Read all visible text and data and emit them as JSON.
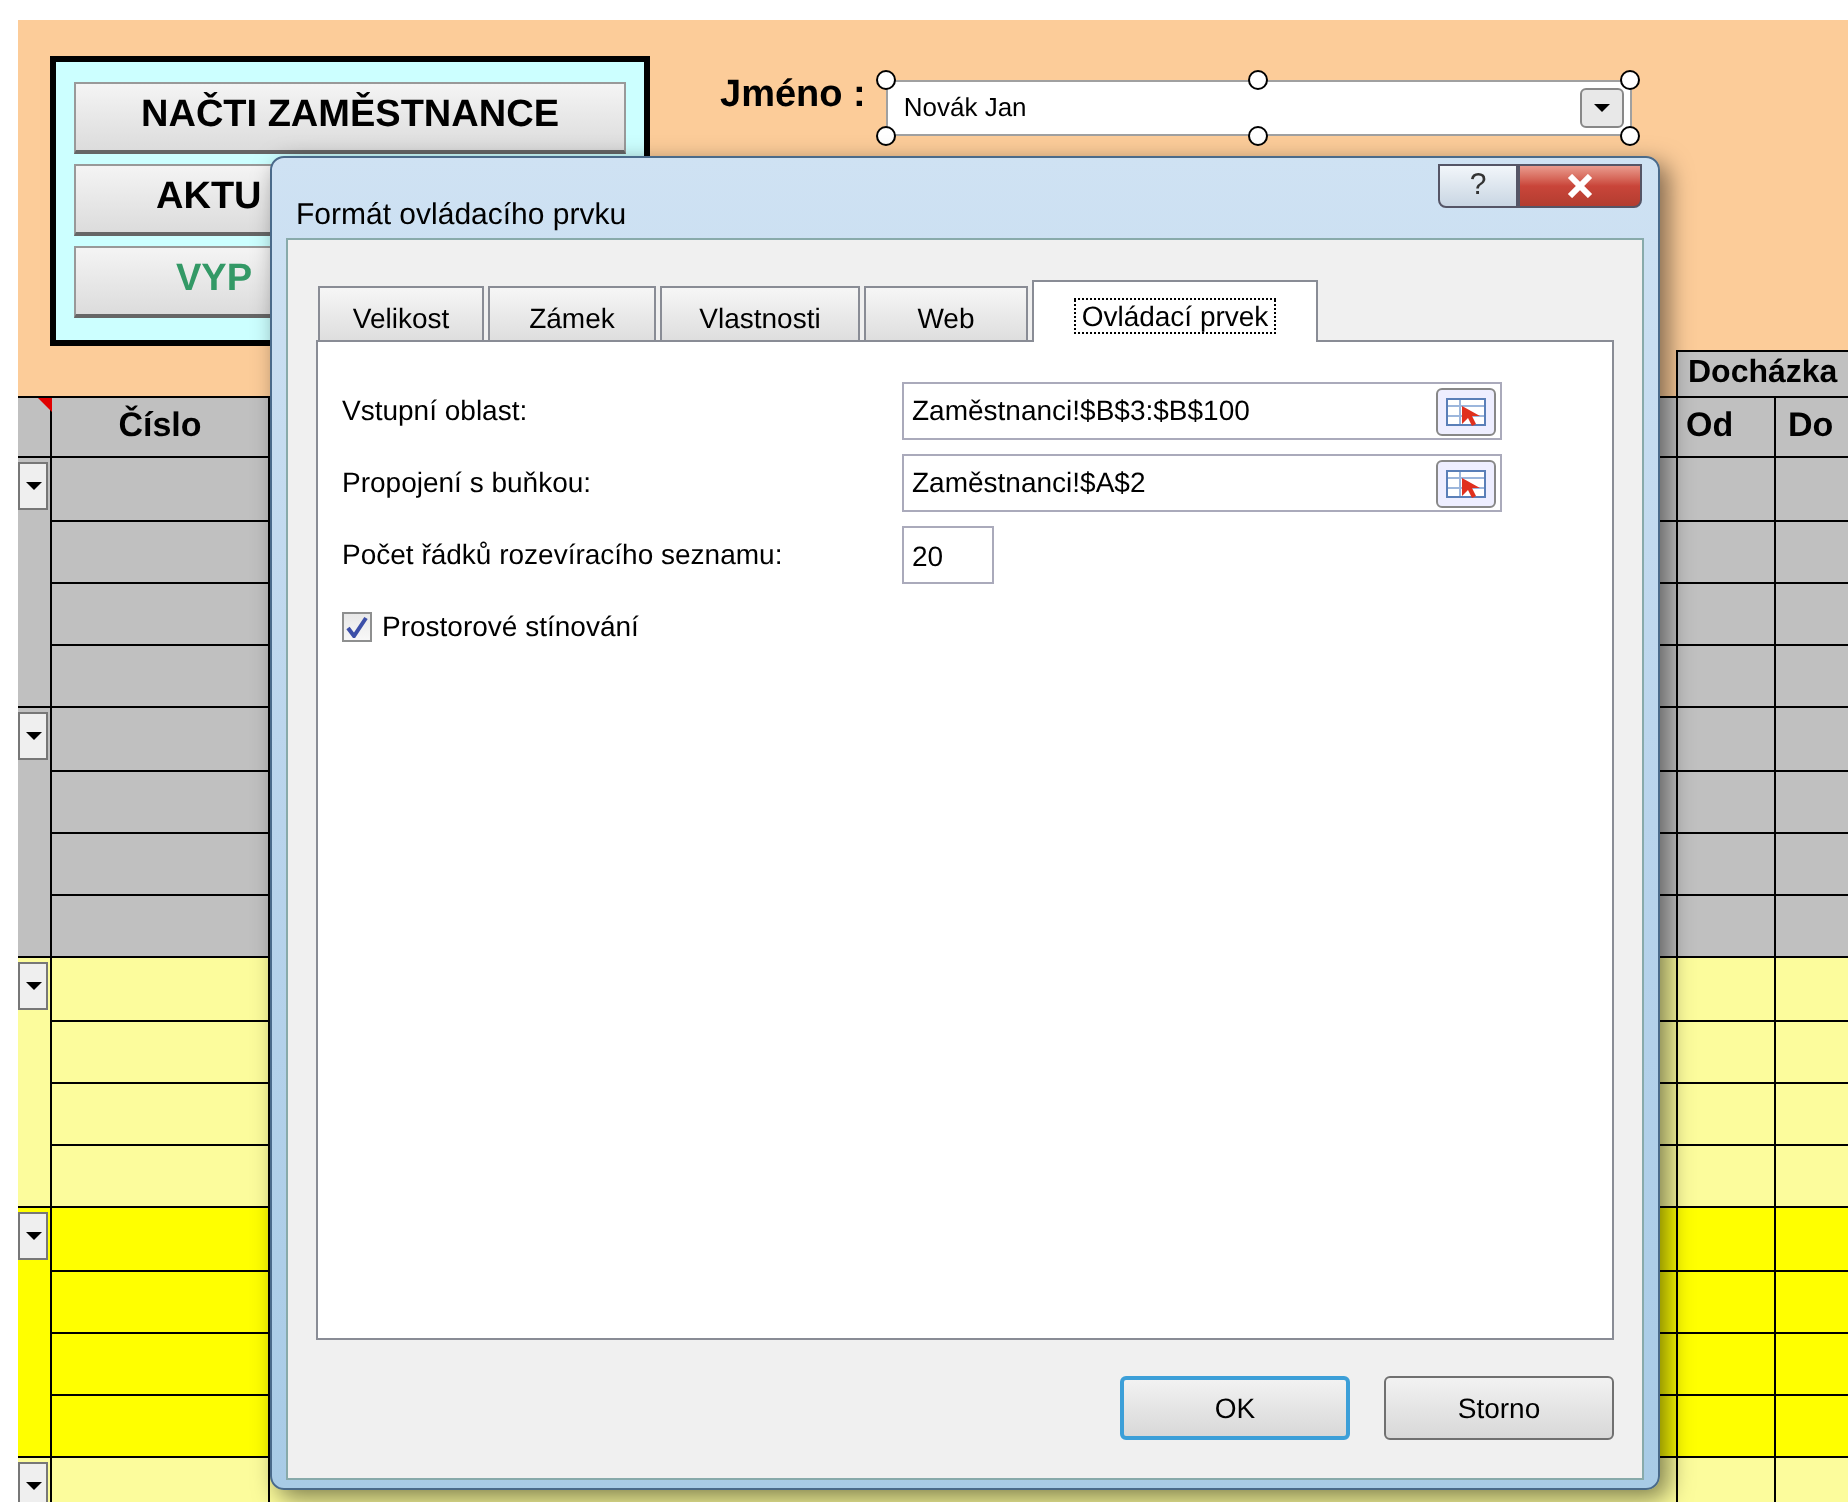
{
  "sheet": {
    "buttons": [
      {
        "label": "NAČTI ZAMĚSTNANCE",
        "color": "#000000"
      },
      {
        "label": "AKTU",
        "color": "#000000"
      },
      {
        "label": "VYP",
        "color": "#339966"
      }
    ],
    "name_label": "Jméno :",
    "name_combo": {
      "value": "Novák Jan"
    },
    "group_header": "Docházka",
    "columns": [
      "Číslo",
      "Od",
      "Do"
    ],
    "row_groups": [
      {
        "color": "#c0c0c0"
      },
      {
        "color": "#c0c0c0"
      },
      {
        "color": "#fcfc9c"
      },
      {
        "color": "#ffff00"
      },
      {
        "color": "#fcfc9c"
      }
    ]
  },
  "dialog": {
    "title": "Formát ovládacího prvku",
    "help": "?",
    "tabs": [
      {
        "label": "Velikost",
        "selected": false
      },
      {
        "label": "Zámek",
        "selected": false
      },
      {
        "label": "Vlastnosti",
        "selected": false
      },
      {
        "label": "Web",
        "selected": false
      },
      {
        "label": "Ovládací prvek",
        "selected": true
      }
    ],
    "fields": [
      {
        "kind": "range",
        "label": "Vstupní oblast:",
        "value": "Zaměstnanci!$B$3:$B$100"
      },
      {
        "kind": "range",
        "label": "Propojení s buňkou:",
        "value": "Zaměstnanci!$A$2"
      },
      {
        "kind": "number",
        "label": "Počet řádků rozevíracího seznamu:",
        "value": "20"
      }
    ],
    "checkbox": {
      "label": "Prostorové stínování",
      "checked": true
    },
    "buttons": [
      {
        "label": "OK",
        "default": true
      },
      {
        "label": "Storno",
        "default": false
      }
    ]
  }
}
